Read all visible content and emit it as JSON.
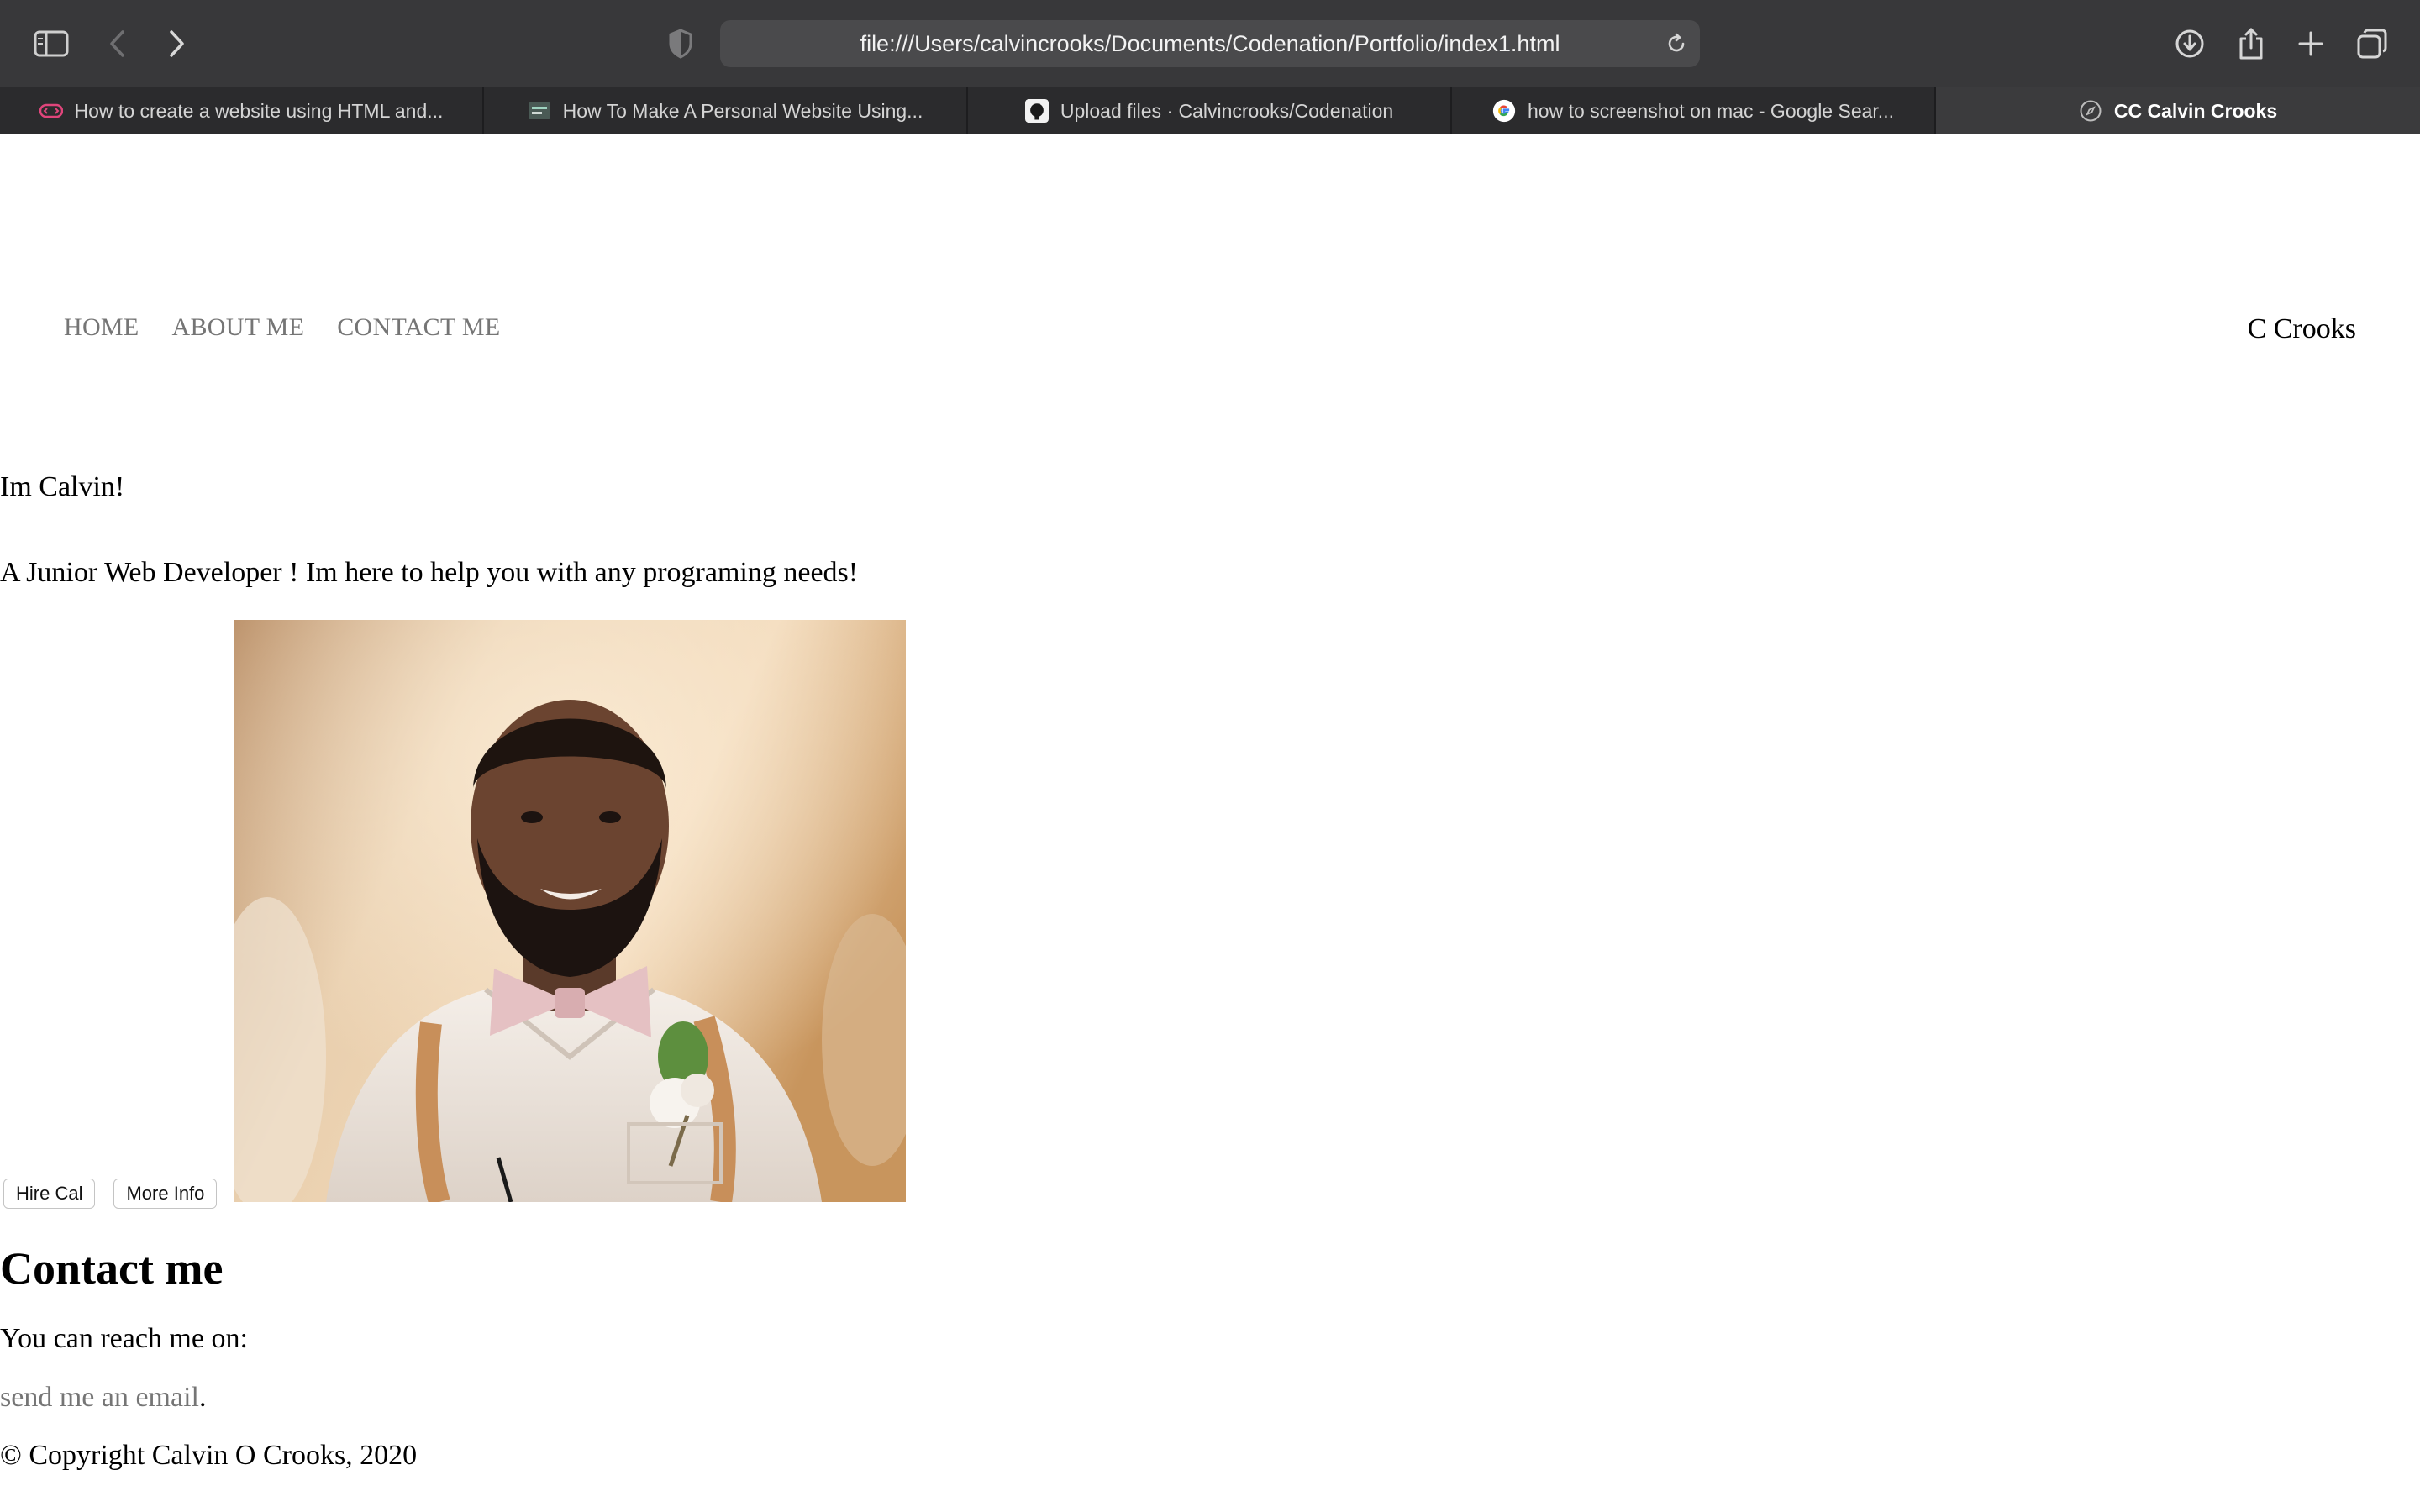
{
  "browser": {
    "url": "file:///Users/calvincrooks/Documents/Codenation/Portfolio/index1.html",
    "tabs": [
      {
        "title": "How to create a website using HTML and...",
        "icon": "code-tag-icon",
        "active": false
      },
      {
        "title": "How To Make A Personal Website Using...",
        "icon": "site-thumbnail-icon",
        "active": false
      },
      {
        "title": "Upload files · Calvincrooks/Codenation",
        "icon": "github-icon",
        "active": false
      },
      {
        "title": "how to screenshot on mac - Google Sear...",
        "icon": "google-icon",
        "active": false
      },
      {
        "title": "CC Calvin Crooks",
        "icon": "compass-icon",
        "active": true
      }
    ]
  },
  "nav": {
    "items": [
      "HOME",
      "ABOUT ME",
      "CONTACT ME"
    ],
    "brand": "C Crooks"
  },
  "hero": {
    "greeting": "Im Calvin!",
    "tagline": "A Junior Web Developer ! Im here to help you with any programing needs!",
    "buttons": [
      "Hire Cal",
      "More Info"
    ]
  },
  "contact": {
    "heading": "Contact me",
    "reach_text": "You can reach me on:",
    "email_link": "send me an email",
    "email_suffix": "."
  },
  "footer": {
    "copyright": "© Copyright Calvin O Crooks, 2020"
  },
  "colors": {
    "toolbar": "#38383a",
    "tabbar": "#2b2b2d",
    "nav_link": "#757575"
  }
}
